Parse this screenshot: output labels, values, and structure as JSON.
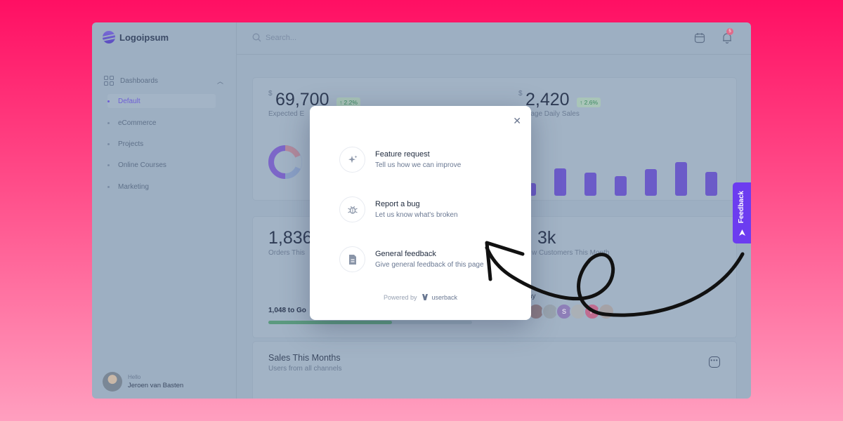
{
  "app": {
    "logo": "Logoipsum",
    "search_placeholder": "Search...",
    "notification_count": "5"
  },
  "sidebar": {
    "section": "Dashboards",
    "items": [
      {
        "label": "Default",
        "active": true
      },
      {
        "label": "eCommerce",
        "active": false
      },
      {
        "label": "Projects",
        "active": false
      },
      {
        "label": "Online Courses",
        "active": false
      },
      {
        "label": "Marketing",
        "active": false
      }
    ],
    "user": {
      "greeting": "Hello",
      "name": "Jeroen van Basten"
    }
  },
  "dashboard": {
    "card1": {
      "currency": "$",
      "value": "69,700",
      "change": "↑ 2.2%",
      "label": "Expected E"
    },
    "card2": {
      "currency": "$",
      "value": "2,420",
      "change": "↑ 2.6%",
      "label": "rage Daily Sales"
    },
    "orders": {
      "value": "1,836",
      "label": "Orders This"
    },
    "customers": {
      "value": "3k",
      "label": "w Customers This Month"
    },
    "goal": {
      "text": "1,048 to Go",
      "progress": 0.6
    },
    "heroes_label": "ay",
    "avatars": [
      "S",
      "P"
    ],
    "sales": {
      "title": "Sales This Months",
      "subtitle": "Users from all channels"
    }
  },
  "modal": {
    "options": [
      {
        "title": "Feature request",
        "desc": "Tell us how we can improve",
        "icon": "sparkle-icon"
      },
      {
        "title": "Report a bug",
        "desc": "Let us know what's broken",
        "icon": "bug-icon"
      },
      {
        "title": "General feedback",
        "desc": "Give general feedback of this page",
        "icon": "document-icon"
      }
    ],
    "powered_by": "Powered by",
    "brand": "userback"
  },
  "feedback_tab": {
    "label": "Feedback"
  },
  "colors": {
    "background_top": "#ff0f63",
    "background_bottom": "#ff9fbf",
    "accent": "#6c3cf0",
    "bars": "#6b5bc8"
  }
}
